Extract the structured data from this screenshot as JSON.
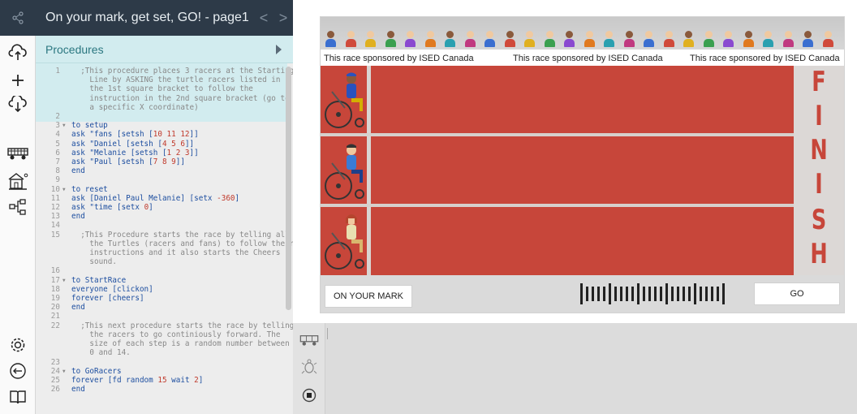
{
  "header": {
    "title": "On your mark, get set, GO! - page1",
    "prev": "<",
    "next": ">"
  },
  "procedures": {
    "label": "Procedures"
  },
  "code_lines": [
    {
      "n": "1",
      "fold": "",
      "parts": [
        {
          "t": "  ;This procedure places 3 racers at the Starting",
          "c": "cmt"
        }
      ]
    },
    {
      "n": "",
      "fold": "",
      "parts": [
        {
          "t": "    Line by ASKING the turtle racers listed in",
          "c": "cmt"
        }
      ]
    },
    {
      "n": "",
      "fold": "",
      "parts": [
        {
          "t": "    the 1st square bracket to follow the",
          "c": "cmt"
        }
      ]
    },
    {
      "n": "",
      "fold": "",
      "parts": [
        {
          "t": "    instruction in the 2nd square bracket (go to",
          "c": "cmt"
        }
      ]
    },
    {
      "n": "",
      "fold": "",
      "parts": [
        {
          "t": "    a specific X coordinate)",
          "c": "cmt"
        }
      ]
    },
    {
      "n": "2",
      "fold": "",
      "parts": []
    },
    {
      "n": "3",
      "fold": "▾",
      "parts": [
        {
          "t": "to setup",
          "c": "txt"
        }
      ]
    },
    {
      "n": "4",
      "fold": "",
      "parts": [
        {
          "t": "ask \"fans [setsh [",
          "c": "txt"
        },
        {
          "t": "10 11 12",
          "c": "num"
        },
        {
          "t": "]]",
          "c": "txt"
        }
      ]
    },
    {
      "n": "5",
      "fold": "",
      "parts": [
        {
          "t": "ask \"Daniel [setsh [",
          "c": "txt"
        },
        {
          "t": "4 5 6",
          "c": "num"
        },
        {
          "t": "]]",
          "c": "txt"
        }
      ]
    },
    {
      "n": "6",
      "fold": "",
      "parts": [
        {
          "t": "ask \"Melanie [setsh [",
          "c": "txt"
        },
        {
          "t": "1 2 3",
          "c": "num"
        },
        {
          "t": "]]",
          "c": "txt"
        }
      ]
    },
    {
      "n": "7",
      "fold": "",
      "parts": [
        {
          "t": "ask \"Paul [setsh [",
          "c": "txt"
        },
        {
          "t": "7 8 9",
          "c": "num"
        },
        {
          "t": "]]",
          "c": "txt"
        }
      ]
    },
    {
      "n": "8",
      "fold": "",
      "parts": [
        {
          "t": "end",
          "c": "txt"
        }
      ]
    },
    {
      "n": "9",
      "fold": "",
      "parts": []
    },
    {
      "n": "10",
      "fold": "▾",
      "parts": [
        {
          "t": "to reset",
          "c": "txt"
        }
      ]
    },
    {
      "n": "11",
      "fold": "",
      "parts": [
        {
          "t": "ask [Daniel Paul Melanie] [setx ",
          "c": "txt"
        },
        {
          "t": "-360",
          "c": "num"
        },
        {
          "t": "]",
          "c": "txt"
        }
      ]
    },
    {
      "n": "12",
      "fold": "",
      "parts": [
        {
          "t": "ask \"time [setx ",
          "c": "txt"
        },
        {
          "t": "0",
          "c": "num"
        },
        {
          "t": "]",
          "c": "txt"
        }
      ]
    },
    {
      "n": "13",
      "fold": "",
      "parts": [
        {
          "t": "end",
          "c": "txt"
        }
      ]
    },
    {
      "n": "14",
      "fold": "",
      "parts": []
    },
    {
      "n": "15",
      "fold": "",
      "parts": [
        {
          "t": "  ;This Procedure starts the race by telling all",
          "c": "cmt"
        }
      ]
    },
    {
      "n": "",
      "fold": "",
      "parts": [
        {
          "t": "    the Turtles (racers and fans) to follow their",
          "c": "cmt"
        }
      ]
    },
    {
      "n": "",
      "fold": "",
      "parts": [
        {
          "t": "    instructions and it also starts the Cheers",
          "c": "cmt"
        }
      ]
    },
    {
      "n": "",
      "fold": "",
      "parts": [
        {
          "t": "    sound.",
          "c": "cmt"
        }
      ]
    },
    {
      "n": "16",
      "fold": "",
      "parts": []
    },
    {
      "n": "17",
      "fold": "▾",
      "parts": [
        {
          "t": "to StartRace",
          "c": "txt"
        }
      ]
    },
    {
      "n": "18",
      "fold": "",
      "parts": [
        {
          "t": "everyone [clickon]",
          "c": "txt"
        }
      ]
    },
    {
      "n": "19",
      "fold": "",
      "parts": [
        {
          "t": "forever [cheers]",
          "c": "txt"
        }
      ]
    },
    {
      "n": "20",
      "fold": "",
      "parts": [
        {
          "t": "end",
          "c": "txt"
        }
      ]
    },
    {
      "n": "21",
      "fold": "",
      "parts": []
    },
    {
      "n": "22",
      "fold": "",
      "parts": [
        {
          "t": "  ;This next procedure starts the race by telling",
          "c": "cmt"
        }
      ]
    },
    {
      "n": "",
      "fold": "",
      "parts": [
        {
          "t": "    the racers to go continiously forward. The",
          "c": "cmt"
        }
      ]
    },
    {
      "n": "",
      "fold": "",
      "parts": [
        {
          "t": "    size of each step is a random number between",
          "c": "cmt"
        }
      ]
    },
    {
      "n": "",
      "fold": "",
      "parts": [
        {
          "t": "    0 and 14.",
          "c": "cmt"
        }
      ]
    },
    {
      "n": "23",
      "fold": "",
      "parts": []
    },
    {
      "n": "24",
      "fold": "▾",
      "parts": [
        {
          "t": "to GoRacers",
          "c": "txt"
        }
      ]
    },
    {
      "n": "25",
      "fold": "",
      "parts": [
        {
          "t": "forever [fd random ",
          "c": "txt"
        },
        {
          "t": "15",
          "c": "num"
        },
        {
          "t": " wait ",
          "c": "txt"
        },
        {
          "t": "2",
          "c": "num"
        },
        {
          "t": "]",
          "c": "txt"
        }
      ]
    },
    {
      "n": "26",
      "fold": "",
      "parts": [
        {
          "t": "end",
          "c": "txt"
        }
      ]
    }
  ],
  "stage": {
    "sponsor_text": "This race sponsored by ISED Canada",
    "finish_letters": [
      "F",
      "I",
      "N",
      "I",
      "S",
      "H"
    ],
    "on_your_mark": "ON YOUR MARK",
    "go": "GO"
  },
  "colors": {
    "track": "#c7463a",
    "topbar": "#2d3a48",
    "proc_header": "#d2ecef"
  },
  "icons": {
    "left_toolbar": [
      "cloud-upload-icon",
      "plus-icon",
      "cloud-download-icon",
      "turtle-cart-icon",
      "home-icon",
      "flowchart-icon",
      "settings-icon",
      "exit-icon",
      "book-icon"
    ],
    "bottom_toolbar": [
      "turtle-cart-icon",
      "turtle-icon",
      "stop-icon"
    ]
  }
}
